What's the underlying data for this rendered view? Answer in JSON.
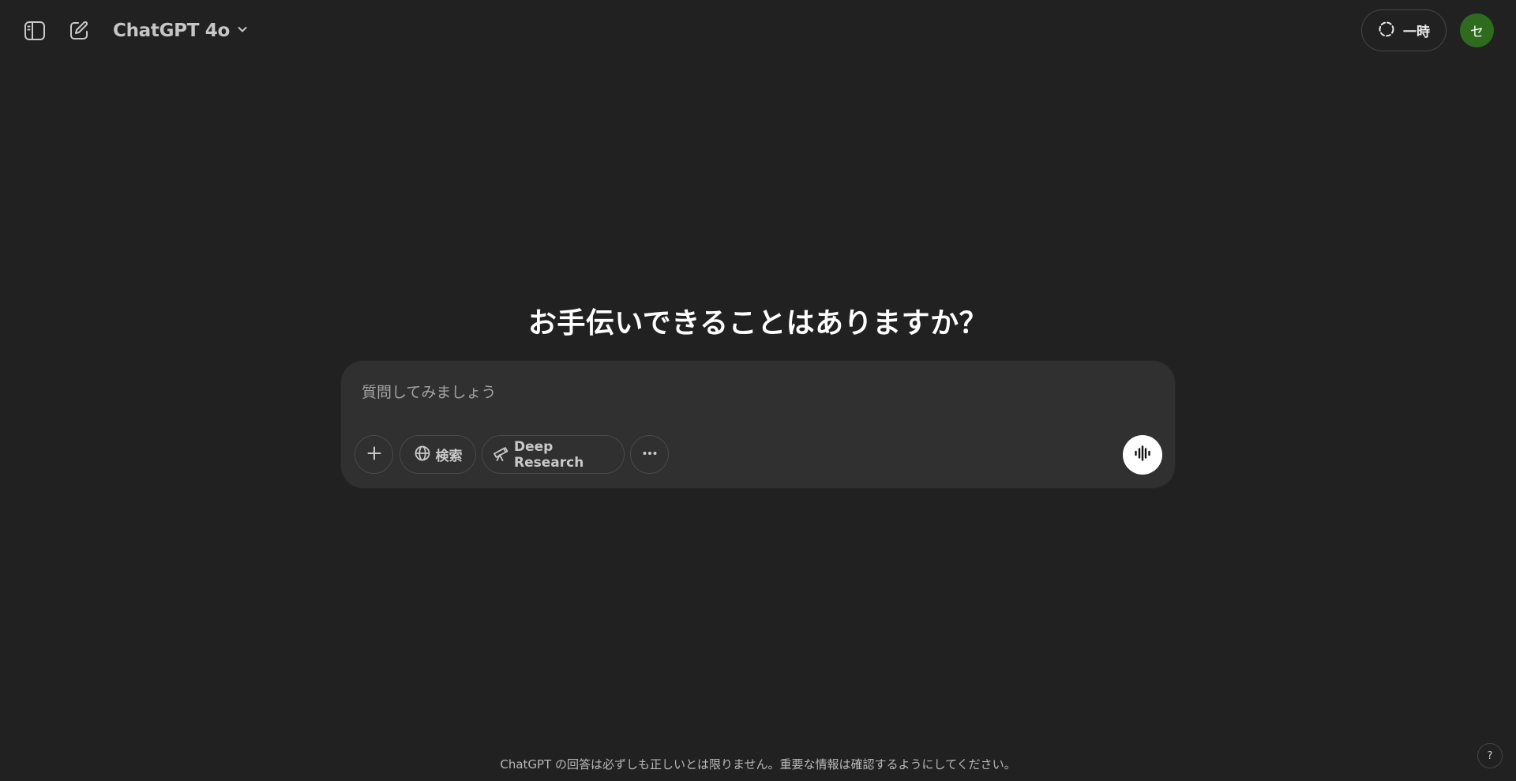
{
  "header": {
    "model_label": "ChatGPT 4o",
    "temporary_label": "一時",
    "avatar_initial": "セ"
  },
  "main": {
    "headline": "お手伝いできることはありますか？",
    "composer": {
      "placeholder": "質問してみましょう",
      "value": "",
      "tools": {
        "search_label": "検索",
        "deep_research_label": "Deep Research"
      }
    }
  },
  "footer": {
    "disclaimer": "ChatGPT の回答は必ずしも正しいとは限りません。重要な情報は確認するようにしてください。",
    "help_label": "?"
  },
  "icons": {
    "sidebar": "sidebar-toggle-icon",
    "new_chat": "compose-icon",
    "model_chevron": "chevron-down-icon",
    "temporary": "dashed-circle-icon",
    "plus": "plus-icon",
    "search": "globe-icon",
    "deep_research": "telescope-icon",
    "more": "ellipsis-icon",
    "voice": "voice-waveform-icon"
  },
  "colors": {
    "background": "#212121",
    "composer": "#303030",
    "avatar": "#2e6b1f",
    "voice_button": "#ffffff"
  }
}
